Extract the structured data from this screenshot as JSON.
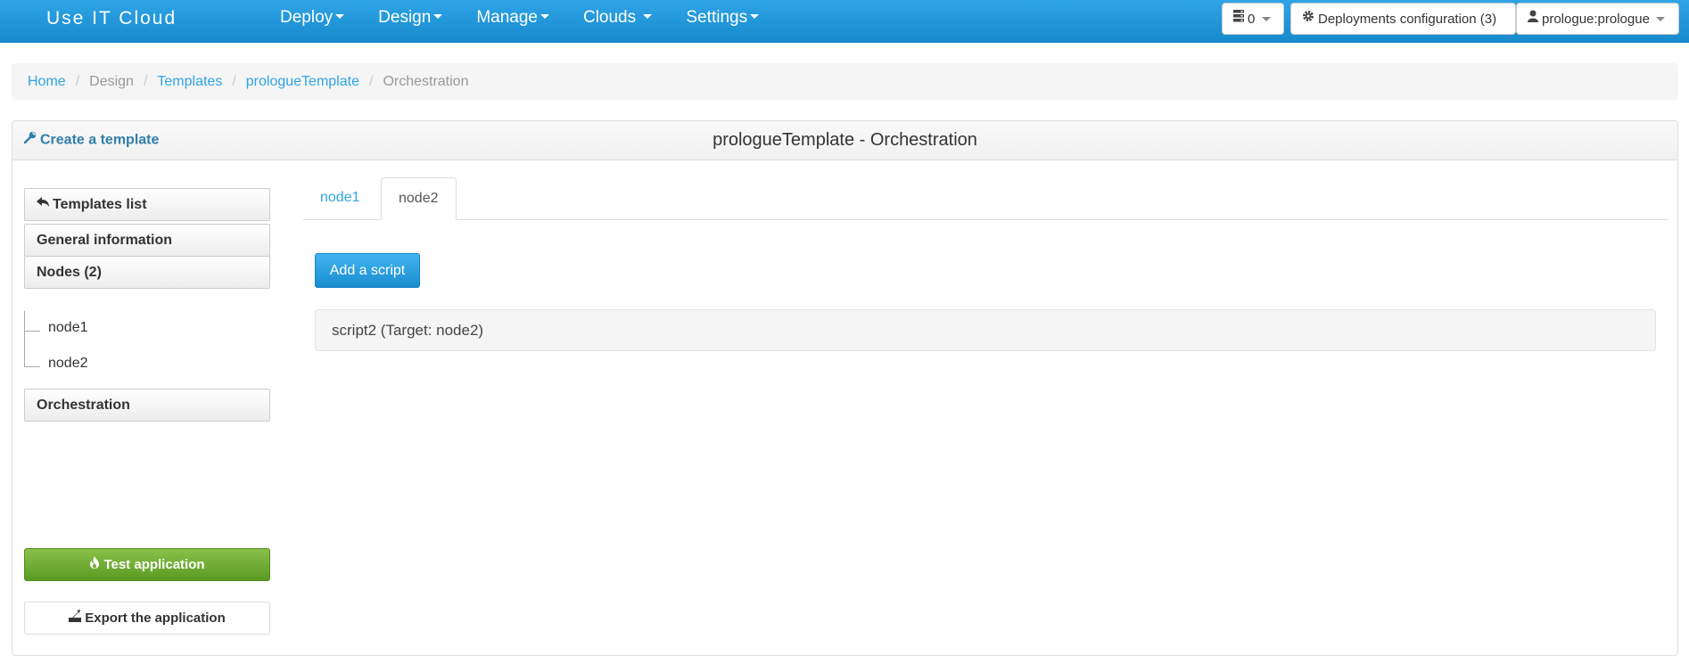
{
  "navbar": {
    "brand": "Use IT Cloud",
    "menu": [
      {
        "label": "Deploy"
      },
      {
        "label": "Design"
      },
      {
        "label": "Manage"
      },
      {
        "label": "Clouds"
      },
      {
        "label": "Settings"
      }
    ],
    "servers_count": "0",
    "deployments_config_label": "Deployments configuration (3)",
    "user_label": "prologue:prologue"
  },
  "breadcrumb": {
    "home": "Home",
    "design": "Design",
    "templates": "Templates",
    "template_name": "prologueTemplate",
    "current": "Orchestration"
  },
  "panel": {
    "create_link": "Create a template",
    "title": "prologueTemplate - Orchestration"
  },
  "sidebar": {
    "templates_list": "Templates list",
    "general_information": "General information",
    "nodes": "Nodes (2)",
    "node_items": [
      "node1",
      "node2"
    ],
    "orchestration": "Orchestration",
    "test_application": "Test application",
    "export_application": "Export the application"
  },
  "main": {
    "tabs": [
      {
        "label": "node1",
        "active": false
      },
      {
        "label": "node2",
        "active": true
      }
    ],
    "add_script_label": "Add a script",
    "scripts": [
      {
        "label": "script2 (Target: node2)"
      }
    ]
  },
  "colors": {
    "navbar": "#2fa4e7",
    "link": "#2fa4e7",
    "success": "#73a839"
  }
}
